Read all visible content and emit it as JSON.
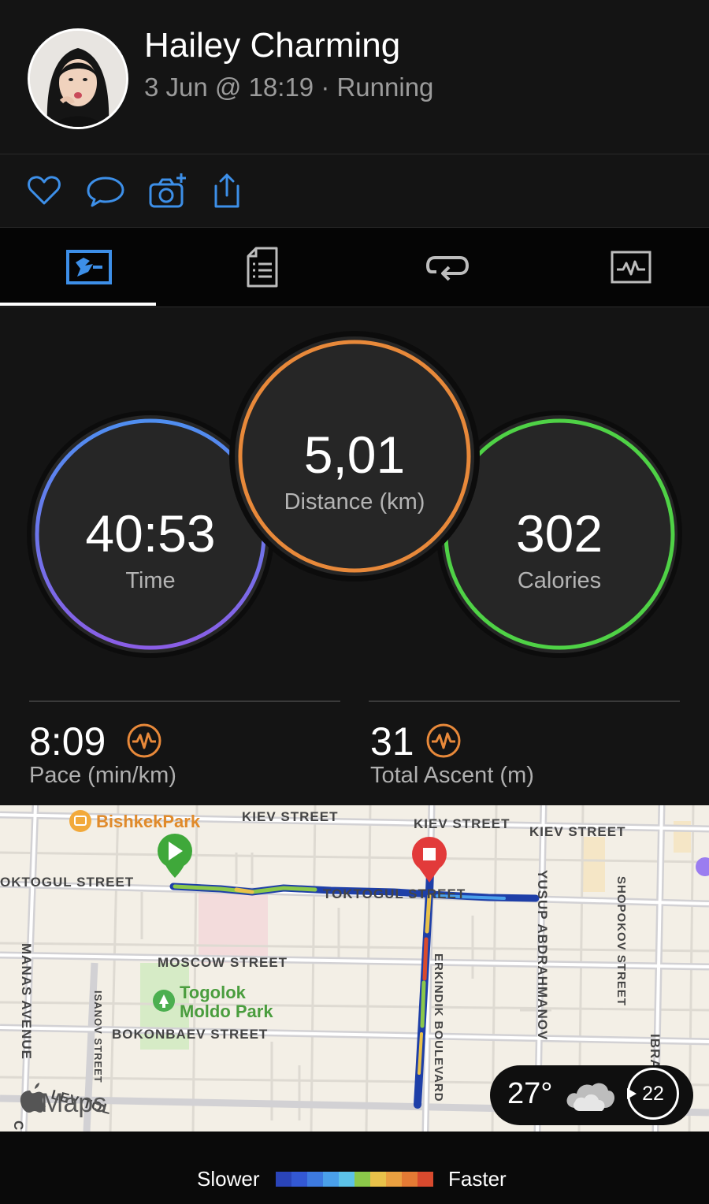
{
  "header": {
    "user_name": "Hailey Charming",
    "activity_meta": "3 Jun @ 18:19 · Running"
  },
  "actions": {
    "icons": [
      "heart-icon",
      "comment-icon",
      "add-photo-icon",
      "share-icon"
    ]
  },
  "tabs": {
    "icons": [
      "overview-icon",
      "details-icon",
      "laps-icon",
      "charts-icon"
    ],
    "active_index": 0
  },
  "stats": {
    "time": {
      "value": "40:53",
      "label": "Time"
    },
    "distance": {
      "value": "5,01",
      "label": "Distance (km)"
    },
    "calories": {
      "value": "302",
      "label": "Calories"
    },
    "pace": {
      "value": "8:09",
      "label": "Pace (min/km)"
    },
    "ascent": {
      "value": "31",
      "label": "Total Ascent (m)"
    }
  },
  "colors": {
    "time_ring": "#7a6af0",
    "distance_ring": "#e8893a",
    "calories_ring": "#4fd246",
    "accent_blue": "#3d8fe8",
    "metric_icon": "#e8893a"
  },
  "map": {
    "places": {
      "bishkek_park": "BishkekPark",
      "togolok_line1": "Togolok",
      "togolok_line2": "Moldo Park"
    },
    "streets": {
      "kiev1": "KIEV STREET",
      "kiev2": "KIEV STREET",
      "kiev3": "KIEV STREET",
      "toktogul_left": "OKTOGUL STREET",
      "toktogul_mid": "TOKTOGUL STREET",
      "moscow": "MOSCOW STREET",
      "bokonbaev": "BOKONBAEV STREET",
      "manas": "MANAS AVENUE",
      "isanov": "ISANOV STREET",
      "lev_tol": "LEV TOL",
      "erkindik": "ERKINDIK BOULEVARD",
      "yusup": "YUSUP ABDRAHMANOV",
      "shopokov": "SHOPOKOV STREET",
      "ibra": "IBRA",
      "edge_c": "C"
    },
    "watermark": "Maps",
    "weather": {
      "temperature": "27°",
      "wind": "22"
    }
  },
  "legend": {
    "slower": "Slower",
    "faster": "Faster",
    "colors": [
      "#2a44b8",
      "#3358d4",
      "#3d7ae0",
      "#4aa0ea",
      "#5cc2e8",
      "#8bc84a",
      "#e9c24a",
      "#eaa040",
      "#e47a34",
      "#d84a2e"
    ]
  }
}
